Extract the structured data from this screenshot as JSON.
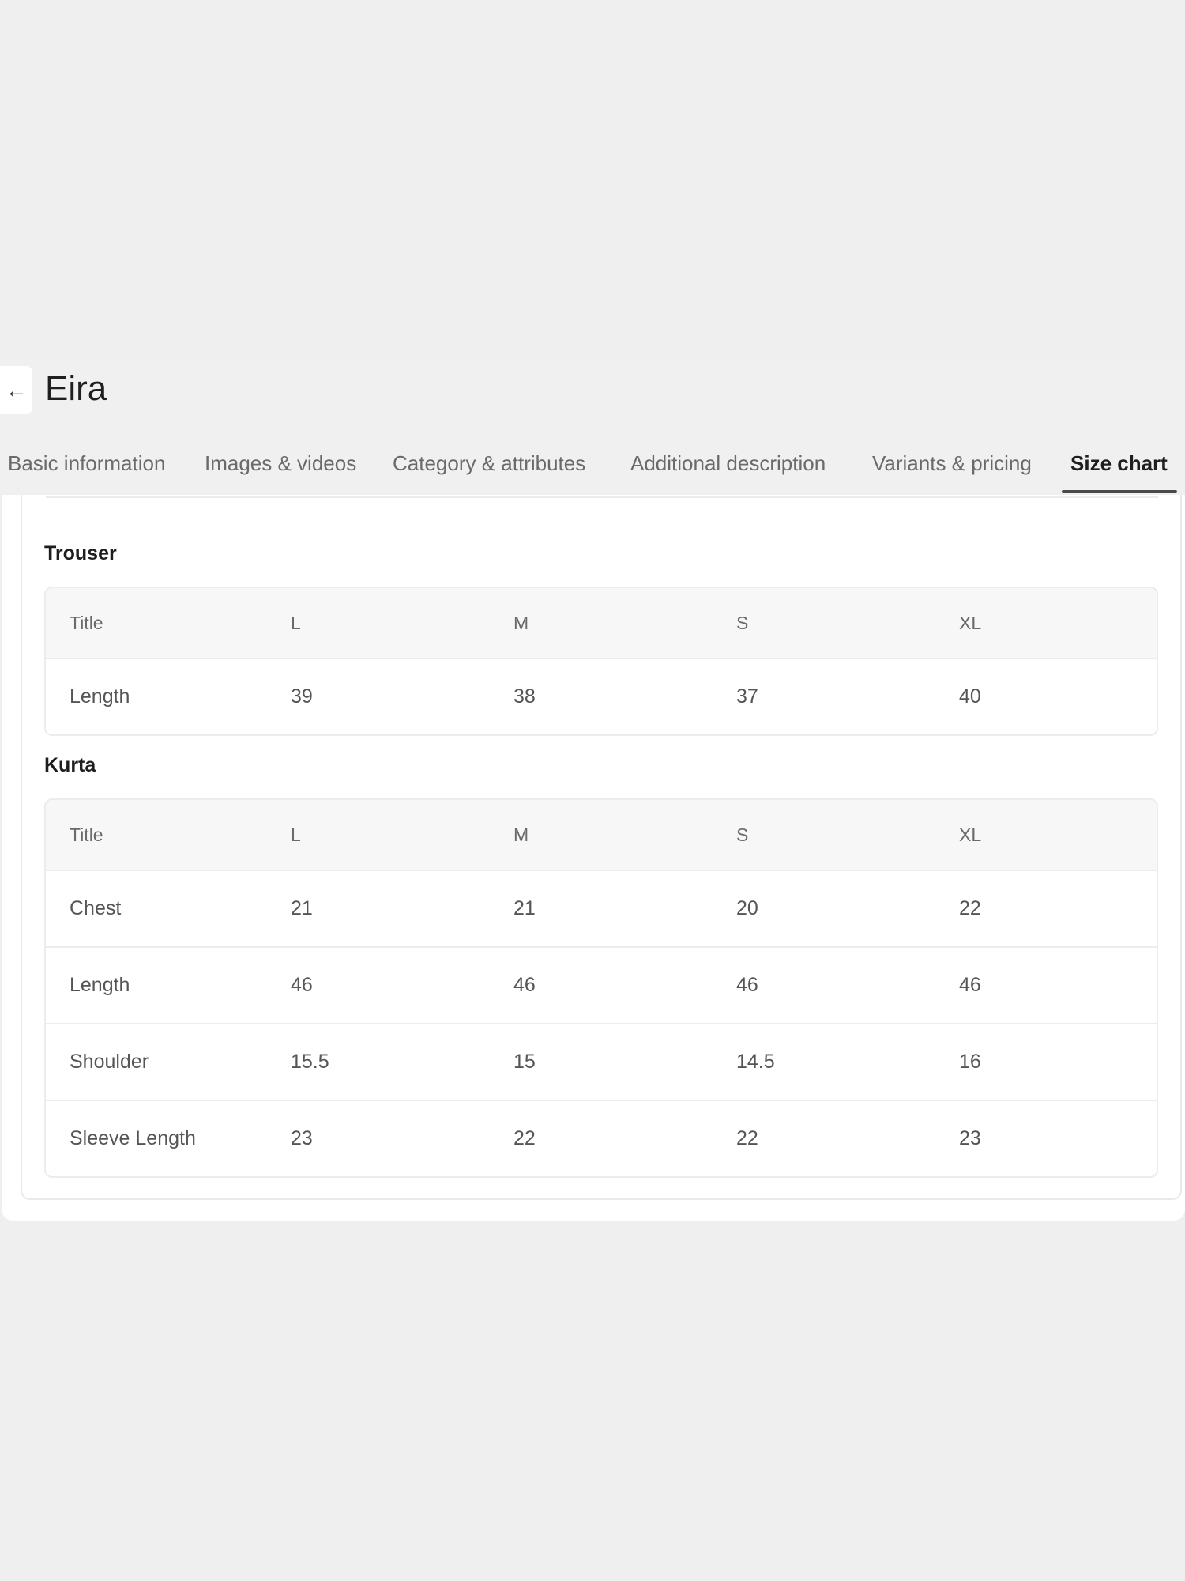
{
  "header": {
    "back_icon": "arrow-left-icon",
    "title": "Eira"
  },
  "tabs": [
    {
      "label": "Basic information",
      "active": false
    },
    {
      "label": "Images & videos",
      "active": false
    },
    {
      "label": "Category & attributes",
      "active": false
    },
    {
      "label": "Additional description",
      "active": false
    },
    {
      "label": "Variants & pricing",
      "active": false
    },
    {
      "label": "Size chart",
      "active": true
    }
  ],
  "size_chart": {
    "trouser": {
      "title": "Trouser",
      "columns": [
        "Title",
        "L",
        "M",
        "S",
        "XL"
      ],
      "rows": [
        [
          "Length",
          "39",
          "38",
          "37",
          "40"
        ]
      ]
    },
    "kurta": {
      "title": "Kurta",
      "columns": [
        "Title",
        "L",
        "M",
        "S",
        "XL"
      ],
      "rows": [
        [
          "Chest",
          "21",
          "21",
          "20",
          "22"
        ],
        [
          "Length",
          "46",
          "46",
          "46",
          "46"
        ],
        [
          "Shoulder",
          "15.5",
          "15",
          "14.5",
          "16"
        ],
        [
          "Sleeve Length",
          "23",
          "22",
          "22",
          "23"
        ]
      ]
    }
  }
}
